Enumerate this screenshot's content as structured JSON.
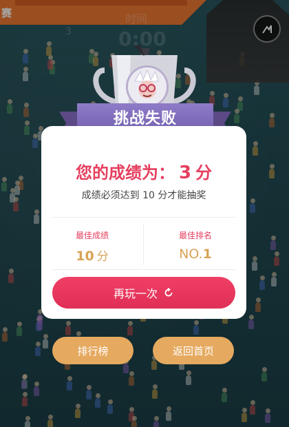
{
  "top_banner": {
    "text": "赛"
  },
  "timer": {
    "label": "时间",
    "value": "0:00",
    "score": "3"
  },
  "dialog": {
    "title": "挑战失败",
    "score_prefix": "您的成绩为：",
    "score_value": "3",
    "score_unit": "分",
    "hint": "成绩必须达到 10 分才能抽奖",
    "best_score": {
      "label": "最佳成绩",
      "value": "10",
      "unit": "分"
    },
    "best_rank": {
      "label": "最佳排名",
      "prefix": "NO.",
      "value": "1"
    },
    "replay_label": "再玩一次"
  },
  "buttons": {
    "leaderboard": "排行榜",
    "home": "返回首页"
  },
  "icons": {
    "skip": "skip-icon",
    "replay": "refresh-icon",
    "trophy": "trophy-icon",
    "avatar": "avatar-icon"
  },
  "colors": {
    "accent_red": "#e5405f",
    "gold": "#d9a356",
    "ribbon_purple": "#7562b0",
    "pill_orange": "#e5a95f",
    "banner_orange": "#ee7a34"
  }
}
